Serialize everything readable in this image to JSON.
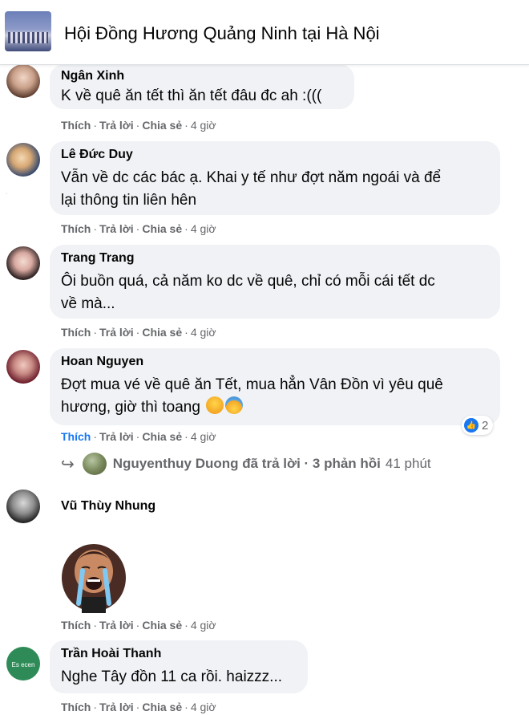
{
  "header": {
    "group_name": "Hội Đồng Hương Quảng Ninh tại Hà Nội"
  },
  "action_labels": {
    "like": "Thích",
    "reply": "Trả lời",
    "share": "Chia sẻ"
  },
  "comments": [
    {
      "author": "Ngân Xinh",
      "lines": [
        "K về quê ăn tết thì ăn tết đâu đc ah :((("
      ],
      "time": "4 giờ"
    },
    {
      "author": "Lê Đức Duy",
      "lines": [
        "Vẫn về dc các bác ạ. Khai y tế như đợt năm ngoái và để",
        "lại thông tin liên hên"
      ],
      "time": "4 giờ"
    },
    {
      "author": "Trang Trang",
      "lines": [
        "Ôi buồn quá, cả năm ko dc về quê, chỉ có mỗi cái tết dc",
        "về mà..."
      ],
      "time": "4 giờ"
    },
    {
      "author": "Hoan Nguyen",
      "lines": [
        "Đợt mua vé về quê ăn Tết, mua hẳn Vân Đồn vì yêu quê",
        "hương, giờ thì toang"
      ],
      "time": "4 giờ",
      "reactions": {
        "icon": "like-icon",
        "count": "2"
      },
      "liked": true
    },
    {
      "author": "Vũ Thùy Nhung",
      "lines": [],
      "time": "4 giờ",
      "sticker": "crying-girl-sticker"
    },
    {
      "author": "Trần Hoài Thanh",
      "lines": [
        "Nghe Tây đồn 11 ca rồi. haizzz..."
      ],
      "time": "4 giờ"
    }
  ],
  "reply_summary": {
    "text": "Nguyenthuy Duong đã trả lời · 3 phản hồi",
    "time": "41 phút"
  },
  "colors": {
    "bubble": "#f0f2f5",
    "meta": "#65676b",
    "accent": "#1877f2"
  }
}
